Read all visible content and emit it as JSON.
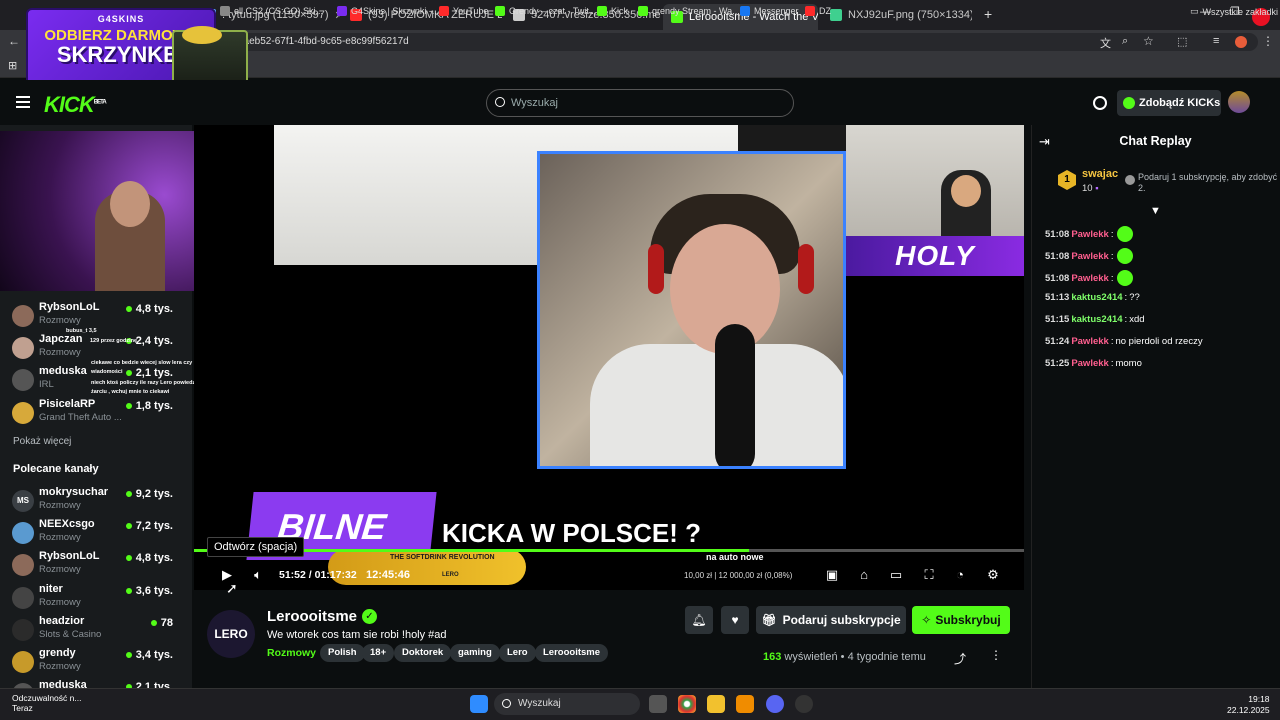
{
  "browser": {
    "tabs": [
      {
        "label": ". tytuu.jpg (1150×597)",
        "color": "#5aa9ff"
      },
      {
        "label": "(93) POZIOMKA ZERUJE LITRA",
        "color": "#ff2a2a"
      },
      {
        "label": "52407.vresize.350.350.medium",
        "color": "#cccccc"
      },
      {
        "label": "Leroooitsme - Watch the V",
        "color": "#53fc18",
        "active": true
      },
      {
        "label": "NXJ92uF.png (750×1334)",
        "color": "#3fd08f"
      }
    ],
    "url": "9aeb52-67f1-4fbd-9c65-e8c99f56217d",
    "bookmarks": [
      {
        "label": "ell CS2 (CS:GO) Ski...",
        "color": "#888888"
      },
      {
        "label": "G4Skins | Skrzynki -...",
        "color": "#7a2cf0"
      },
      {
        "label": "YouTube",
        "color": "#ff2a2a"
      },
      {
        "label": "Grendy – czat - Twit...",
        "color": "#53fc18"
      },
      {
        "label": "Kick",
        "color": "#53fc18"
      },
      {
        "label": "grendy Stream - Wa...",
        "color": "#53fc18"
      },
      {
        "label": "Messenger",
        "color": "#1877f2"
      },
      {
        "label": "DZ",
        "color": "#ff2a2a"
      }
    ],
    "all_bookmarks": "Wszystkie zakładki"
  },
  "ad": {
    "brand": "G4SKINS",
    "line1": "ODBIERZ DARMOWĄ",
    "line2": "SKRZYNKĘ!"
  },
  "header": {
    "logo": "KICK",
    "logo_badge": "BETA",
    "search_placeholder": "Wyszukaj",
    "kicks_label": "Zdobądź KICKs"
  },
  "sidebar": {
    "channels_top": [
      {
        "name": "RybsonLoL",
        "category": "Rozmowy",
        "viewers": "4,8 tys.",
        "color": "#8c6a5a"
      },
      {
        "name": "Japczan",
        "category": "Rozmowy",
        "viewers": "2,4 tys.",
        "color": "#c0a090"
      },
      {
        "name": "meduska",
        "category": "IRL",
        "viewers": "2,1 tys.",
        "color": "#555555"
      },
      {
        "name": "PisicelaRP",
        "category": "Grand Theft Auto ...",
        "viewers": "1,8 tys.",
        "color": "#d7a93a"
      }
    ],
    "show_more": "Pokaż więcej",
    "recommended_title": "Polecane kanały",
    "channels_recommended": [
      {
        "name": "mokrysuchar",
        "category": "Rozmowy",
        "viewers": "9,2 tys.",
        "initials": "MS",
        "color": "#3a3f44"
      },
      {
        "name": "NEEXcsgo",
        "category": "Rozmowy",
        "viewers": "7,2 tys.",
        "color": "#5a9ad0"
      },
      {
        "name": "RybsonLoL",
        "category": "Rozmowy",
        "viewers": "4,8 tys.",
        "color": "#8c6a5a"
      },
      {
        "name": "niter",
        "category": "Rozmowy",
        "viewers": "3,6 tys.",
        "color": "#444444"
      },
      {
        "name": "headzior",
        "category": "Slots & Casino",
        "viewers": "78",
        "color": "#2b2b2b"
      },
      {
        "name": "grendy",
        "category": "Rozmowy",
        "viewers": "3,4 tys.",
        "color": "#c79a2a"
      },
      {
        "name": "meduska",
        "category": "",
        "viewers": "2,1 tys.",
        "color": "#555555"
      }
    ],
    "overlay_chat": [
      "bubus_t 3,5",
      "129 przez godzinę",
      "ciekawe co bedzie wiecej slow lera czy",
      "wiadomości",
      "niech ktoś policzy ile razy Lero powiedział o",
      "żarciu , wchuj mnie to ciekawi"
    ]
  },
  "video": {
    "overlay_headline": "KICKA W POLSCE! ?",
    "lower_box_text": "BILNE",
    "holy": "HOLY",
    "energy_text": "THE SOFTDRINK REVOLUTION",
    "energy_sub": "LERO",
    "side_text": "na auto nowe",
    "price_text": "10,00 zł | 12 000,00 zł (0,08%)",
    "tooltip": "Odtwórz (spacja)",
    "current_time": "51:52",
    "total_time": "01:17:32",
    "live_clock": "12:45:46",
    "progress": 0.669
  },
  "stream": {
    "avatar_text": "LERO",
    "streamer": "Leroooitsme",
    "title": "We wtorek cos tam sie robi !holy #ad",
    "category": "Rozmowy",
    "tags": [
      "Polish",
      "18+",
      "Doktorek",
      "gaming",
      "Lero",
      "Leroooitsme"
    ],
    "gift_label": "Podaruj subskrypcje",
    "subscribe_label": "Subskrybuj",
    "views_count": "163",
    "views_label": "wyświetleń",
    "ago": "4 tygodnie temu"
  },
  "chat": {
    "title": "Chat Replay",
    "pinned": {
      "rank": "1",
      "name": "swajac",
      "count": "10",
      "message": "Podaruj 1 subskrypcję, aby zdobyć 2."
    },
    "messages": [
      {
        "time": "51:08",
        "user": "Pawlekk",
        "text": "",
        "emote": true,
        "color": "#ff5f8f"
      },
      {
        "time": "51:08",
        "user": "Pawlekk",
        "text": "",
        "emote": true,
        "color": "#ff5f8f"
      },
      {
        "time": "51:08",
        "user": "Pawlekk",
        "text": "",
        "emote": true,
        "color": "#ff5f8f"
      },
      {
        "time": "51:13",
        "user": "kaktus2414",
        "text": "??",
        "emote": false,
        "color": "#7fff6a"
      },
      {
        "time": "51:15",
        "user": "kaktus2414",
        "text": "xdd",
        "emote": false,
        "color": "#7fff6a"
      },
      {
        "time": "51:24",
        "user": "Pawlekk",
        "text": "no pierdoli od rzeczy",
        "emote": false,
        "color": "#ff5f8f"
      },
      {
        "time": "51:25",
        "user": "Pawlekk",
        "text": "momo",
        "emote": false,
        "color": "#ff5f8f"
      }
    ]
  },
  "taskbar": {
    "notification_title": "Odczuwalność n...",
    "notification_sub": "Teraz",
    "search": "Wyszukaj",
    "time": "19:18",
    "date": "22.12.2025"
  }
}
